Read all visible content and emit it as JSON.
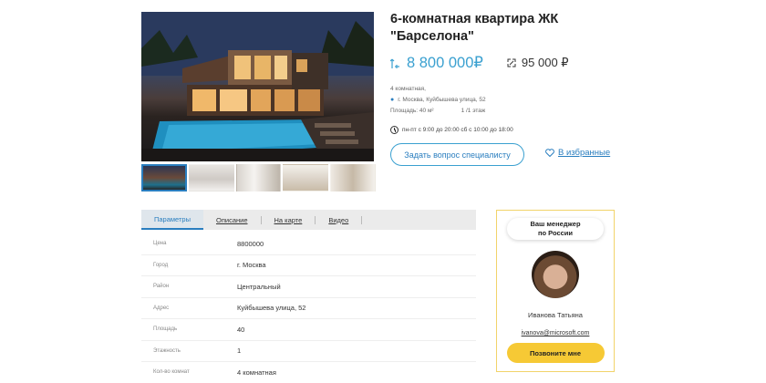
{
  "listing": {
    "title_line1": "6-комнатная квартира ЖК",
    "title_line2": "\"Барселона\"",
    "price": "8 800 000₽",
    "price_per_sqm": "95 000 ₽",
    "rooms": "4 комнатная,",
    "address": "г. Москва, Куйбышева улица, 52",
    "area": "Площадь: 40 м²",
    "floor": "1 /1 этаж",
    "hours": "пн-пт с 9:00 до 20:00 сб с 10:00 до 18:00"
  },
  "actions": {
    "ask_label": "Задать вопрос специалисту",
    "favorite_label": "В избранные"
  },
  "tabs": [
    {
      "label": "Параметры"
    },
    {
      "label": "Описание"
    },
    {
      "label": "На карте"
    },
    {
      "label": "Видео"
    }
  ],
  "params": [
    {
      "key": "Цена",
      "value": "8800000"
    },
    {
      "key": "Город",
      "value": "г. Москва"
    },
    {
      "key": "Район",
      "value": "Центральный"
    },
    {
      "key": "Адрес",
      "value": "Куйбышева улица, 52"
    },
    {
      "key": "Площадь",
      "value": "40"
    },
    {
      "key": "Этажность",
      "value": "1"
    },
    {
      "key": "Кол-во комнат",
      "value": "4 комнатная"
    }
  ],
  "manager": {
    "heading_line1": "Ваш менеджер",
    "heading_line2": "по России",
    "name": "Иванова Татьяна",
    "email": "ivanova@microsoft.com",
    "call_label": "Позвоните мне"
  },
  "colors": {
    "accent": "#2a7ebf",
    "price": "#3aa0d0",
    "call_button": "#f6c935",
    "manager_border": "#f2d36a"
  },
  "icons": {
    "price": "price-tag-icon",
    "per_sqm": "area-icon",
    "location": "location-pin-icon",
    "clock": "clock-icon",
    "favorite": "heart-icon"
  }
}
